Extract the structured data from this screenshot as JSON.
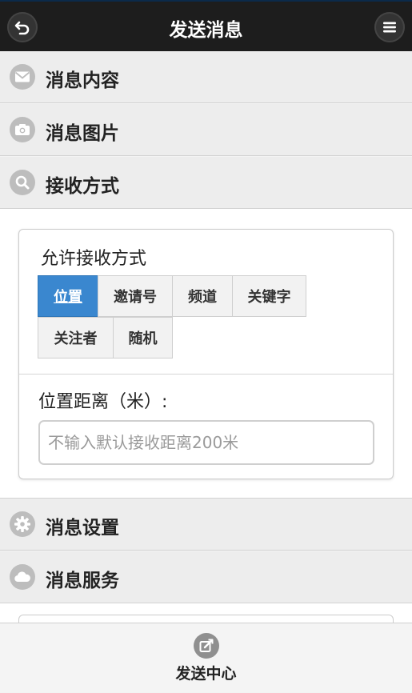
{
  "header": {
    "title": "发送消息",
    "back_icon": "back-arrow-icon",
    "menu_icon": "menu-icon"
  },
  "sections": [
    {
      "label": "消息内容",
      "icon": "envelope-icon"
    },
    {
      "label": "消息图片",
      "icon": "camera-icon"
    },
    {
      "label": "接收方式",
      "icon": "search-icon"
    },
    {
      "label": "消息设置",
      "icon": "gear-icon"
    },
    {
      "label": "消息服务",
      "icon": "cloud-icon"
    }
  ],
  "receive": {
    "allow_label": "允许接收方式",
    "options": [
      "位置",
      "邀请号",
      "频道",
      "关键字",
      "关注者",
      "随机"
    ],
    "selected": "位置",
    "distance_label": "位置距离（米）:",
    "distance_placeholder": "不输入默认接收距离200米",
    "distance_value": ""
  },
  "footer": {
    "label": "发送中心",
    "icon": "send-edit-icon"
  },
  "colors": {
    "header_bg": "#1d1d1d",
    "active": "#3a87cf",
    "section_bg": "#ededed"
  }
}
